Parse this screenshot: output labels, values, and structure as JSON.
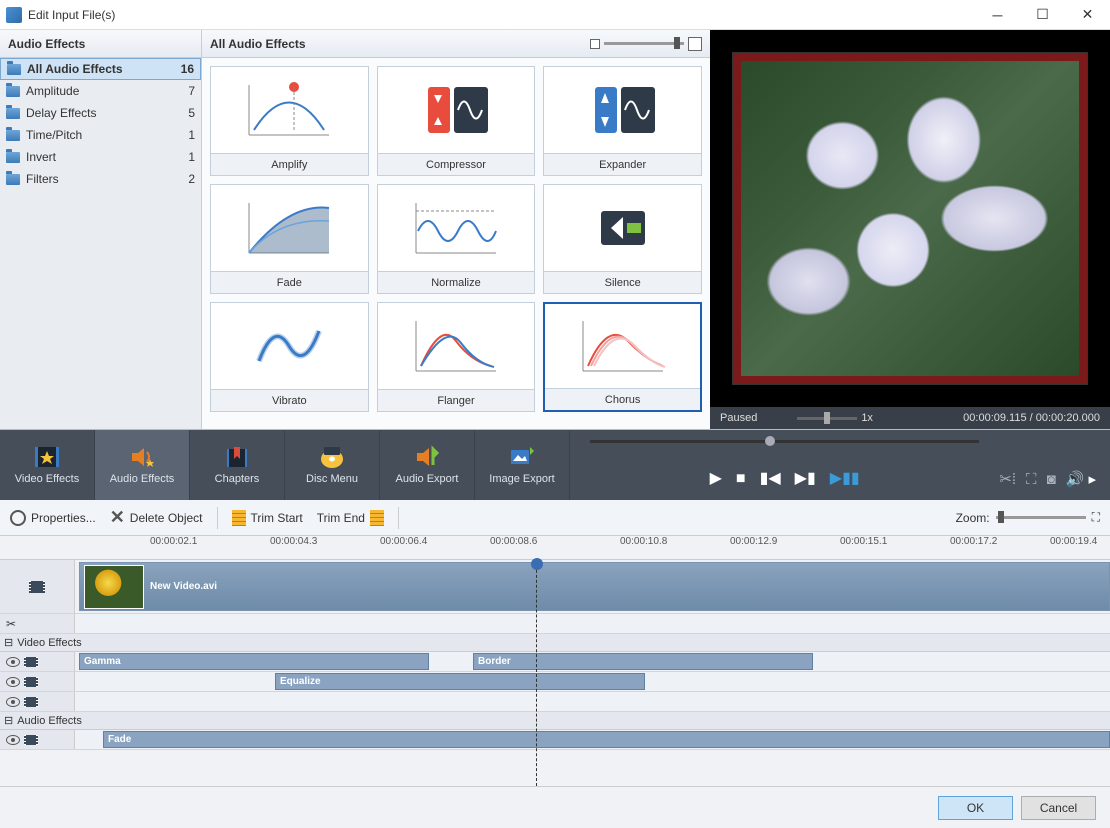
{
  "window": {
    "title": "Edit Input File(s)"
  },
  "sidebar": {
    "header": "Audio Effects",
    "items": [
      {
        "label": "All Audio Effects",
        "count": "16"
      },
      {
        "label": "Amplitude",
        "count": "7"
      },
      {
        "label": "Delay Effects",
        "count": "5"
      },
      {
        "label": "Time/Pitch",
        "count": "1"
      },
      {
        "label": "Invert",
        "count": "1"
      },
      {
        "label": "Filters",
        "count": "2"
      }
    ]
  },
  "effects": {
    "header": "All Audio Effects",
    "items": [
      {
        "label": "Amplify"
      },
      {
        "label": "Compressor"
      },
      {
        "label": "Expander"
      },
      {
        "label": "Fade"
      },
      {
        "label": "Normalize"
      },
      {
        "label": "Silence"
      },
      {
        "label": "Vibrato"
      },
      {
        "label": "Flanger"
      },
      {
        "label": "Chorus"
      }
    ]
  },
  "preview": {
    "status": "Paused",
    "speed": "1x",
    "time_current": "00:00:09.115",
    "time_total": "00:00:20.000"
  },
  "toolbar": {
    "tabs": [
      {
        "label": "Video Effects"
      },
      {
        "label": "Audio Effects"
      },
      {
        "label": "Chapters"
      },
      {
        "label": "Disc Menu"
      },
      {
        "label": "Audio Export"
      },
      {
        "label": "Image Export"
      }
    ]
  },
  "propbar": {
    "properties": "Properties...",
    "delete": "Delete Object",
    "trim_start": "Trim Start",
    "trim_end": "Trim End",
    "zoom_label": "Zoom:"
  },
  "ruler": {
    "ticks": [
      "00:00:02.1",
      "00:00:04.3",
      "00:00:06.4",
      "00:00:08.6",
      "00:00:10.8",
      "00:00:12.9",
      "00:00:15.1",
      "00:00:17.2",
      "00:00:19.4"
    ]
  },
  "clips": {
    "video_name": "New Video.avi",
    "section_video": "Video Effects",
    "section_audio": "Audio Effects",
    "gamma": "Gamma",
    "border": "Border",
    "equalize": "Equalize",
    "fade": "Fade"
  },
  "dialog": {
    "ok": "OK",
    "cancel": "Cancel"
  }
}
